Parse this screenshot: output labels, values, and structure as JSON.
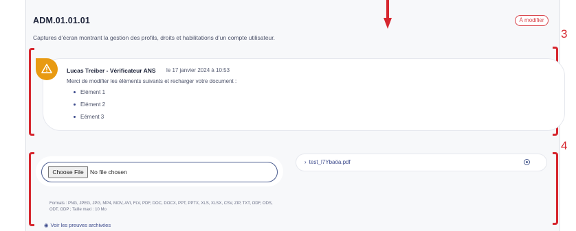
{
  "requirement": {
    "code": "ADM.01.01.01",
    "status_badge": "À modifier",
    "description": "Captures d’écran montrant la gestion des profils, droits et habilitations d’un compte utilisateur."
  },
  "annotations": {
    "label_3": "3",
    "label_4": "4",
    "color": "#d6262e"
  },
  "comment": {
    "icon": "warning-icon",
    "author": "Lucas Treiber - Vérificateur ANS",
    "date": "le 17 janvier 2024 à 10:53",
    "message": "Merci de modifier les éléments suivants et recharger votre document :",
    "items": [
      "Elément 1",
      "Elément 2",
      "Eément 3"
    ]
  },
  "upload": {
    "choose_label": "Choose File",
    "no_file_text": "No file chosen",
    "formats_text": "Formats : PNG, JPEG, JPG, MP4, MOV, AVI, FLV, PDF, DOC, DOCX, PPT, PPTX, XLS, XLSX, CSV, ZIP, TXT, ODF, ODS, ODT, ODP ; Taille maxi : 10 Mo",
    "archived_link": "Voir les preuves archivées"
  },
  "attached_file": {
    "name": "test_l7Ybaöa.pdf",
    "remove_icon": "remove-circle-icon"
  },
  "colors": {
    "warning": "#e89a12",
    "accent": "#3c4a8c",
    "badge_red": "#d9434a"
  }
}
